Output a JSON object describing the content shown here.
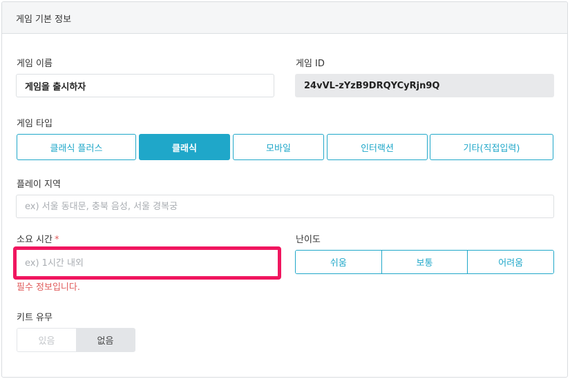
{
  "section": {
    "title": "게임 기본 정보"
  },
  "game_name": {
    "label": "게임 이름",
    "value": "게임을 출시하자"
  },
  "game_id": {
    "label": "게임 ID",
    "value": "24vVL-zYzB9DRQYCyRjn9Q"
  },
  "game_type": {
    "label": "게임 타입",
    "options": [
      "클래식 플러스",
      "클래식",
      "모바일",
      "인터랙션",
      "기타(직접입력)"
    ],
    "selected": "클래식"
  },
  "play_region": {
    "label": "플레이 지역",
    "placeholder": "ex) 서울 동대문, 충북 음성, 서울 경복궁"
  },
  "duration": {
    "label": "소요 시간",
    "required_mark": "*",
    "placeholder": "ex) 1시간 내외",
    "error": "필수 정보입니다."
  },
  "difficulty": {
    "label": "난이도",
    "options": [
      "쉬움",
      "보통",
      "어려움"
    ]
  },
  "kit": {
    "label": "키트 유무",
    "options": [
      "있음",
      "없음"
    ],
    "selected": "없음"
  },
  "colors": {
    "accent": "#1fa7c9",
    "error": "#e05b5b",
    "highlight": "#f0165f"
  }
}
